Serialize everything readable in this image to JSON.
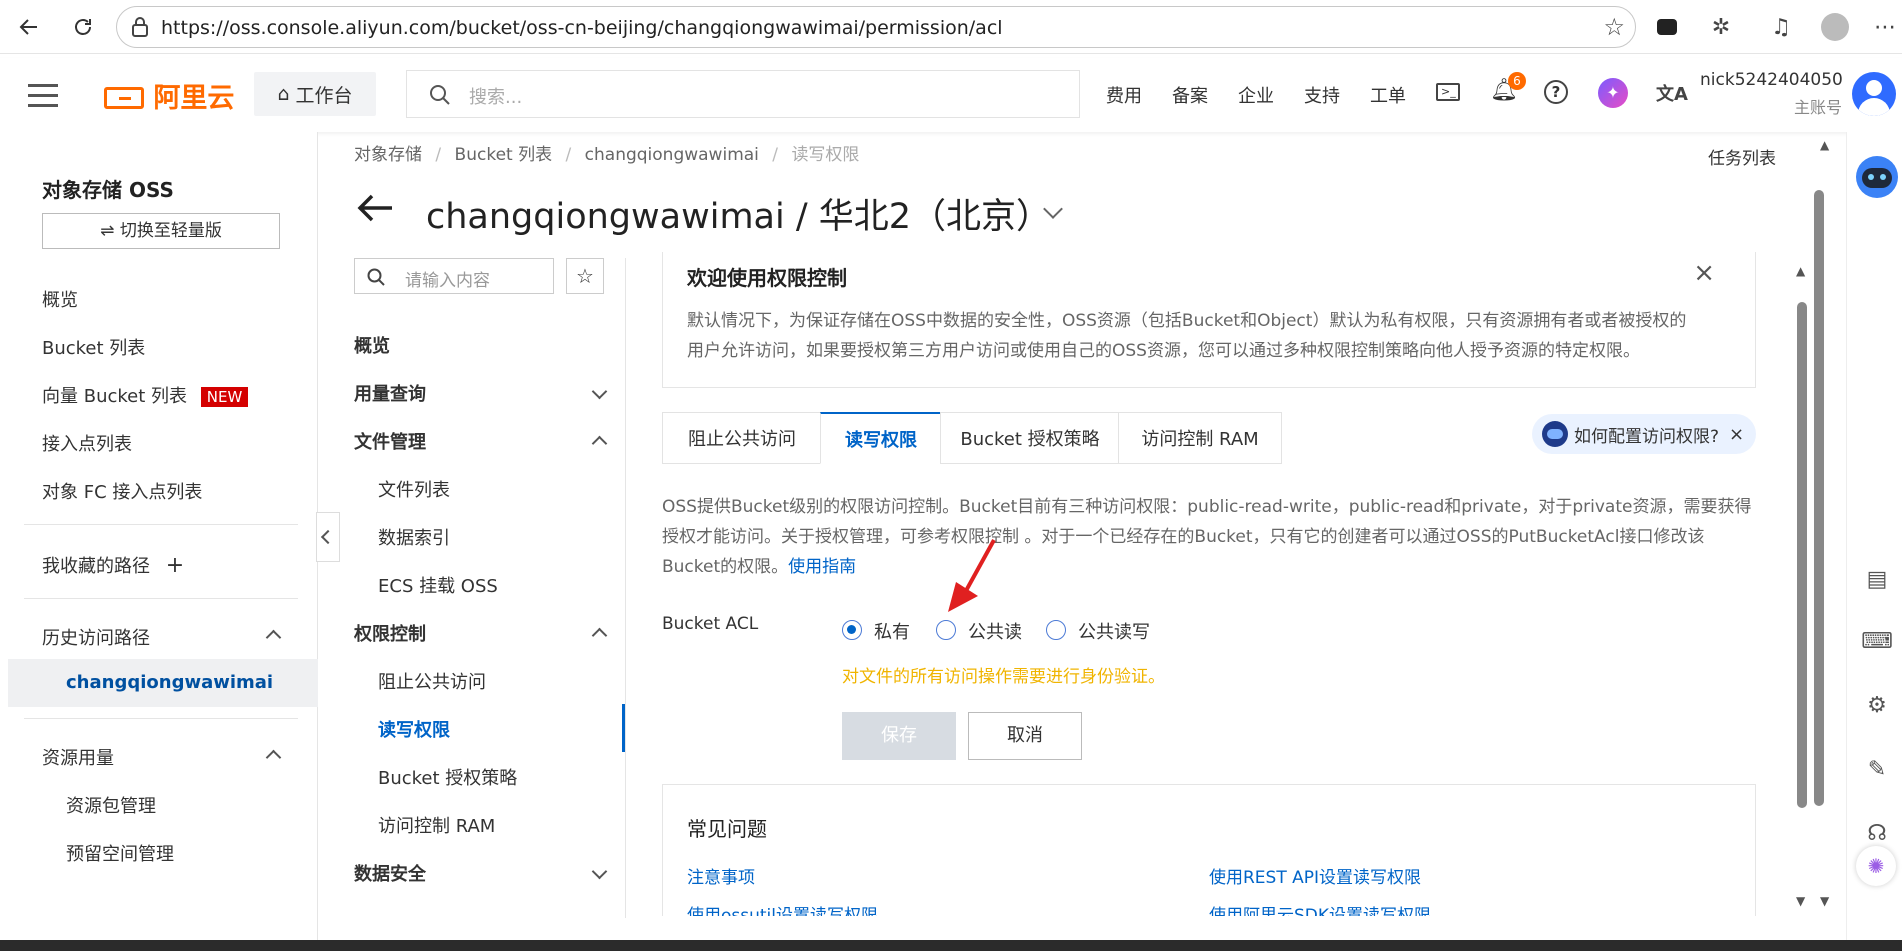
{
  "browser": {
    "url": "https://oss.console.aliyun.com/bucket/oss-cn-beijing/changqiongwawimai/permission/acl"
  },
  "topbar": {
    "logo": "阿里云",
    "workbench": "工作台",
    "search_placeholder": "搜索...",
    "nav": [
      "费用",
      "备案",
      "企业",
      "支持",
      "工单"
    ],
    "notification_count": "6",
    "account_name": "nick5242404050",
    "account_type": "主账号"
  },
  "sidebar": {
    "title": "对象存储 OSS",
    "switch_button": "⇌ 切换至轻量版",
    "items": [
      {
        "label": "概览"
      },
      {
        "label": "Bucket 列表"
      },
      {
        "label": "向量 Bucket 列表",
        "badge": "NEW"
      },
      {
        "label": "接入点列表"
      },
      {
        "label": "对象 FC 接入点列表"
      }
    ],
    "favorites": "我收藏的路径",
    "history": "历史访问路径",
    "history_item": "changqiongwawimai",
    "resources": "资源用量",
    "resource_items": [
      "资源包管理",
      "预留空间管理"
    ]
  },
  "breadcrumb": [
    "对象存储",
    "Bucket 列表",
    "changqiongwawimai",
    "读写权限"
  ],
  "task_list": "任务列表",
  "page_title": "changqiongwawimai / 华北2（北京）",
  "subnav": {
    "search_placeholder": "请输入内容",
    "overview": "概览",
    "usage": "用量查询",
    "file_mgmt": "文件管理",
    "file_items": [
      "文件列表",
      "数据索引",
      "ECS 挂载 OSS"
    ],
    "perm": "权限控制",
    "perm_items": [
      "阻止公共访问",
      "读写权限",
      "Bucket 授权策略",
      "访问控制 RAM"
    ],
    "data_security": "数据安全"
  },
  "welcome": {
    "title": "欢迎使用权限控制",
    "line1": "默认情况下，为保证存储在OSS中数据的安全性，OSS资源（包括Bucket和Object）默认为私有权限，只有资源拥有者或者被授权的",
    "line2": "用户允许访问，如果要授权第三方用户访问或使用自己的OSS资源，您可以通过多种权限控制策略向他人授予资源的特定权限。"
  },
  "tabs": [
    "阻止公共访问",
    "读写权限",
    "Bucket 授权策略",
    "访问控制 RAM"
  ],
  "help_pill": "如何配置访问权限?",
  "desc": {
    "line1": "OSS提供Bucket级别的权限访问控制。Bucket目前有三种访问权限：public-read-write，public-read和private，对于private资源，需要获得",
    "line2": "授权才能访问。关于授权管理，可参考权限控制 。对于一个已经存在的Bucket，只有它的创建者可以通过OSS的PutBucketAcl接口修改该",
    "line3": "Bucket的权限。",
    "link": "使用指南"
  },
  "acl": {
    "label": "Bucket ACL",
    "options": [
      "私有",
      "公共读",
      "公共读写"
    ],
    "selected": "私有",
    "hint": "对文件的所有访问操作需要进行身份验证。",
    "save": "保存",
    "cancel": "取消"
  },
  "faq": {
    "title": "常见问题",
    "links": [
      "注意事项",
      "使用REST API设置读写权限",
      "使用ossutil设置读写权限",
      "使用阿里云SDK设置读写权限"
    ]
  },
  "colors": {
    "brand": "#ff6a00",
    "link": "#0064c8",
    "hint": "#f0b400",
    "badge": "#d40000"
  }
}
